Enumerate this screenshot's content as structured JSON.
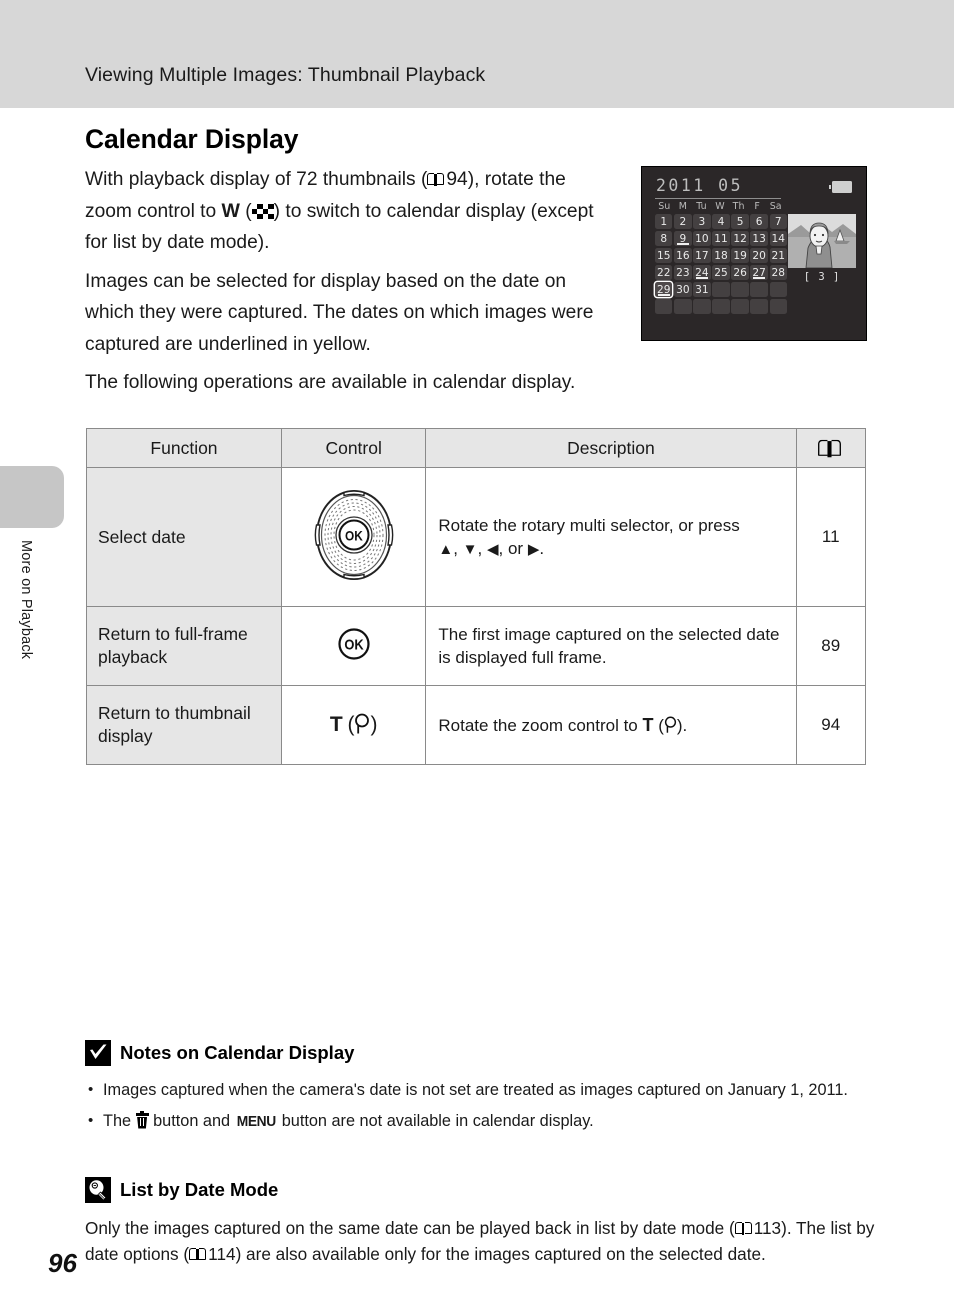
{
  "header": {
    "title": "Viewing Multiple Images: Thumbnail Playback"
  },
  "side": {
    "vertical_label": "More on Playback",
    "page_number": "96"
  },
  "section": {
    "title": "Calendar Display"
  },
  "intro": {
    "p1_a": "With playback display of 72 thumbnails (",
    "p1_ref": "94",
    "p1_b": "), rotate the zoom control to ",
    "p1_w": "W",
    "p1_c": ") to switch to calendar display (except for list by date mode).",
    "p2": "Images can be selected for display based on the date on which they were captured. The dates on which images were captured are underlined in yellow.",
    "p3": "The following operations are available in calendar display."
  },
  "lcd": {
    "year_month": "2011  05",
    "dow": [
      "Su",
      "M",
      "Tu",
      "W",
      "Th",
      "F",
      "Sa"
    ],
    "weeks": [
      [
        {
          "d": "1",
          "marked": false,
          "selected": false
        },
        {
          "d": "2",
          "marked": false,
          "selected": false
        },
        {
          "d": "3",
          "marked": false,
          "selected": false
        },
        {
          "d": "4",
          "marked": false,
          "selected": false
        },
        {
          "d": "5",
          "marked": false,
          "selected": false
        },
        {
          "d": "6",
          "marked": false,
          "selected": false
        },
        {
          "d": "7",
          "marked": false,
          "selected": false
        }
      ],
      [
        {
          "d": "8",
          "marked": false,
          "selected": false
        },
        {
          "d": "9",
          "marked": true,
          "selected": false
        },
        {
          "d": "10",
          "marked": false,
          "selected": false
        },
        {
          "d": "11",
          "marked": false,
          "selected": false
        },
        {
          "d": "12",
          "marked": false,
          "selected": false
        },
        {
          "d": "13",
          "marked": false,
          "selected": false
        },
        {
          "d": "14",
          "marked": false,
          "selected": false
        }
      ],
      [
        {
          "d": "15",
          "marked": false,
          "selected": false
        },
        {
          "d": "16",
          "marked": false,
          "selected": false
        },
        {
          "d": "17",
          "marked": false,
          "selected": false
        },
        {
          "d": "18",
          "marked": false,
          "selected": false
        },
        {
          "d": "19",
          "marked": false,
          "selected": false
        },
        {
          "d": "20",
          "marked": false,
          "selected": false
        },
        {
          "d": "21",
          "marked": false,
          "selected": false
        }
      ],
      [
        {
          "d": "22",
          "marked": false,
          "selected": false
        },
        {
          "d": "23",
          "marked": false,
          "selected": false
        },
        {
          "d": "24",
          "marked": true,
          "selected": false
        },
        {
          "d": "25",
          "marked": false,
          "selected": false
        },
        {
          "d": "26",
          "marked": false,
          "selected": false
        },
        {
          "d": "27",
          "marked": true,
          "selected": false
        },
        {
          "d": "28",
          "marked": false,
          "selected": false
        }
      ],
      [
        {
          "d": "29",
          "marked": true,
          "selected": true
        },
        {
          "d": "30",
          "marked": false,
          "selected": false
        },
        {
          "d": "31",
          "marked": false,
          "selected": false
        },
        {
          "d": "",
          "marked": false,
          "selected": false
        },
        {
          "d": "",
          "marked": false,
          "selected": false
        },
        {
          "d": "",
          "marked": false,
          "selected": false
        },
        {
          "d": "",
          "marked": false,
          "selected": false
        }
      ],
      [
        {
          "d": "",
          "marked": false,
          "selected": false
        },
        {
          "d": "",
          "marked": false,
          "selected": false
        },
        {
          "d": "",
          "marked": false,
          "selected": false
        },
        {
          "d": "",
          "marked": false,
          "selected": false
        },
        {
          "d": "",
          "marked": false,
          "selected": false
        },
        {
          "d": "",
          "marked": false,
          "selected": false
        },
        {
          "d": "",
          "marked": false,
          "selected": false
        }
      ]
    ],
    "count_label": "[    3 ]"
  },
  "table": {
    "headers": [
      "Function",
      "Control",
      "Description",
      "book-icon"
    ],
    "rows": [
      {
        "function": "Select date",
        "control": "rotary-multi-selector",
        "desc_a": "Rotate the rotary multi selector, or press ",
        "desc_b": ", or ",
        "desc_c": ".",
        "page": "11"
      },
      {
        "function": "Return to full-frame playback",
        "control": "ok-button",
        "desc": "The first image captured on the selected date is displayed full frame.",
        "page": "89"
      },
      {
        "function": "Return to thumbnail display",
        "control": "T (magnifier)",
        "desc_a": "Rotate the zoom control to ",
        "desc_t": "T",
        "desc_b": ").",
        "page": "94"
      }
    ]
  },
  "notes": {
    "title": "Notes on Calendar Display",
    "badge": "check-badge-icon",
    "items": [
      "Images captured when the camera's date is not set are treated as images captured on January 1, 2011.",
      "The  button and  button are not available in calendar display."
    ],
    "item2_a": "The ",
    "item2_b": " button and ",
    "item2_menu": "MENU",
    "item2_c": " button are not available in calendar display."
  },
  "listbydate": {
    "title": "List by Date Mode",
    "badge": "lightbulb-badge-icon",
    "para_a": "Only the images captured on the same date can be played back in list by date mode (",
    "ref1": "113",
    "para_b": "). The list by date options (",
    "ref2": "114",
    "para_c": ") are also available only for the images captured on the selected date."
  }
}
